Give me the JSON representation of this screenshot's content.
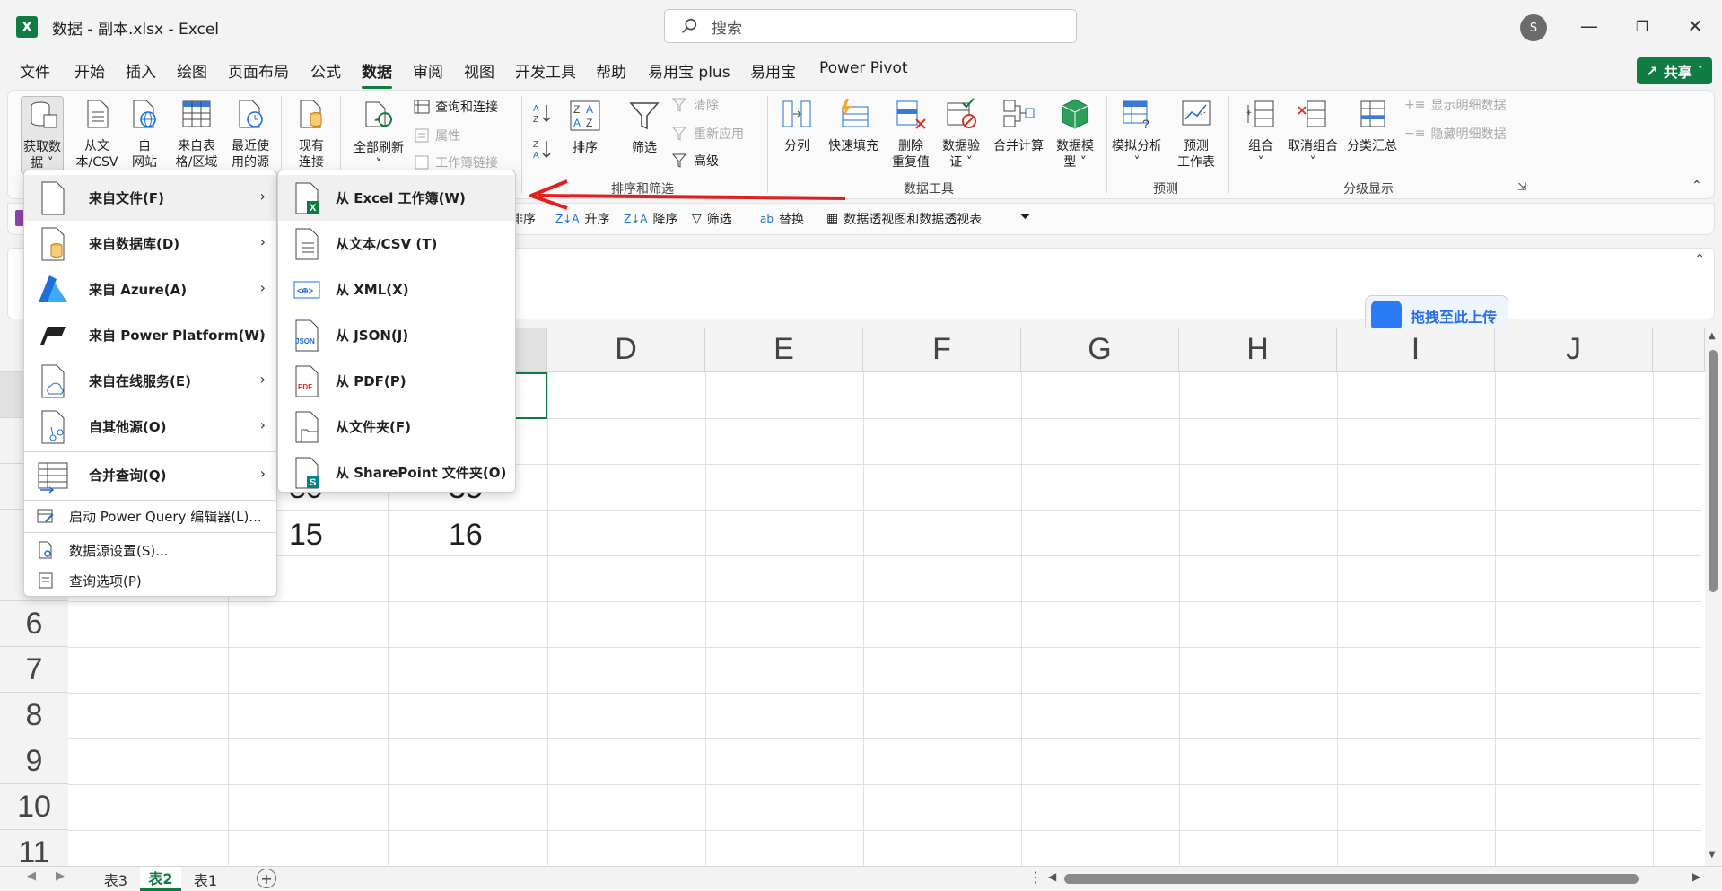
{
  "window": {
    "title": "数据 - 副本.xlsx  -  Excel",
    "search_placeholder": "搜索",
    "avatar": "S"
  },
  "tabs": [
    "文件",
    "开始",
    "插入",
    "绘图",
    "页面布局",
    "公式",
    "数据",
    "审阅",
    "视图",
    "开发工具",
    "帮助",
    "易用宝 plus",
    "易用宝",
    "Power Pivot"
  ],
  "active_tab": "数据",
  "share": "共享",
  "ribbon": {
    "get_data": [
      "获取数",
      "据 ˅"
    ],
    "from_text": [
      "从文",
      "本/CSV"
    ],
    "from_web": [
      "自",
      "网站"
    ],
    "from_table": [
      "来自表",
      "格/区域"
    ],
    "recent": [
      "最近使",
      "用的源"
    ],
    "existing": [
      "现有",
      "连接"
    ],
    "refresh_all": [
      "全部刷新",
      "˅"
    ],
    "queries": "查询和连接",
    "properties": "属性",
    "workbook_links": "工作簿链接",
    "sort": "排序",
    "filter": "筛选",
    "clear": "清除",
    "reapply": "重新应用",
    "advanced": "高级",
    "sort_filter_group": "排序和筛选",
    "split": "分列",
    "flash_fill": "快速填充",
    "remove_dup": [
      "删除",
      "重复值"
    ],
    "validation": [
      "数据验",
      "证 ˅"
    ],
    "consolidate": "合并计算",
    "data_model": [
      "数据模",
      "型 ˅"
    ],
    "data_tools_group": "数据工具",
    "what_if": [
      "模拟分析",
      "˅"
    ],
    "forecast": [
      "预测",
      "工作表"
    ],
    "forecast_group": "预测",
    "group": [
      "组合",
      "˅"
    ],
    "ungroup": [
      "取消组合",
      "˅"
    ],
    "subtotal": "分类汇总",
    "show_detail": "显示明细数据",
    "hide_detail": "隐藏明细数据",
    "outline_group": "分级显示"
  },
  "qat": [
    "排序",
    "升序",
    "降序",
    "筛选",
    "替换",
    "数据透视图和数据透视表"
  ],
  "columns": [
    "D",
    "E",
    "F",
    "G",
    "H",
    "I",
    "J"
  ],
  "rows": [
    "6",
    "7",
    "8",
    "9",
    "10",
    "11"
  ],
  "cells": {
    "b4": "80",
    "c4": "35",
    "b5": "15",
    "c5": "16"
  },
  "upload": "拖拽至此上传",
  "sheets": [
    "表3",
    "表2",
    "表1"
  ],
  "active_sheet": "表2",
  "menu_get_data": {
    "items": [
      "来自文件(F)",
      "来自数据库(D)",
      "来自 Azure(A)",
      "来自 Power Platform(W)",
      "来自在线服务(E)",
      "自其他源(O)",
      "合并查询(Q)"
    ],
    "small_items": [
      "启动 Power Query 编辑器(L)...",
      "数据源设置(S)...",
      "查询选项(P)"
    ]
  },
  "menu_from_file": {
    "items": [
      "从 Excel 工作簿(W)",
      "从文本/CSV (T)",
      "从 XML(X)",
      "从 JSON(J)",
      "从 PDF(P)",
      "从文件夹(F)",
      "从 SharePoint 文件夹(O)"
    ]
  },
  "colors": {
    "accent": "#107c41",
    "annotation_arrow": "#e02020"
  }
}
